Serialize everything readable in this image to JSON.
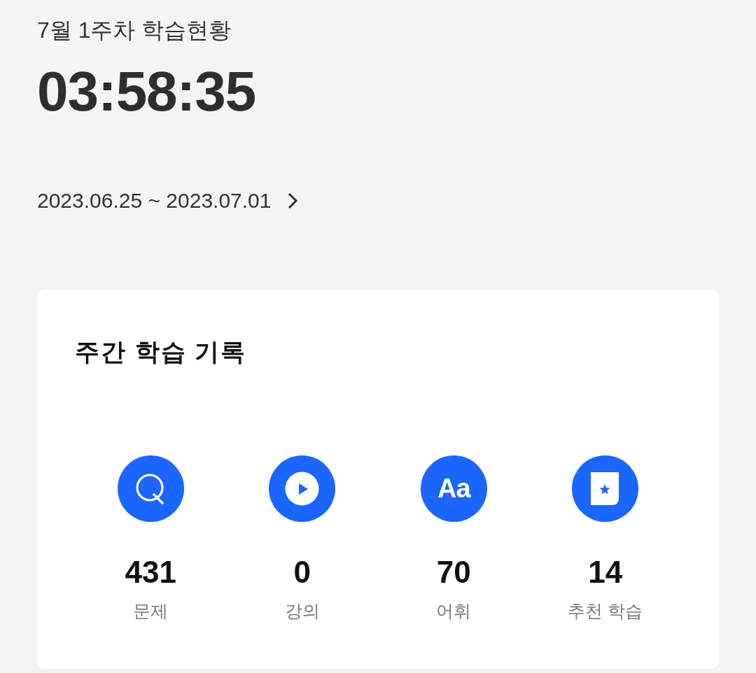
{
  "header": {
    "title": "7월 1주차 학습현황",
    "total_time": "03:58:35",
    "date_range": "2023.06.25 ~ 2023.07.01"
  },
  "weekly_card": {
    "title": "주간 학습 기록",
    "stats": [
      {
        "kind": "question",
        "value": "431",
        "label": "문제"
      },
      {
        "kind": "play",
        "value": "0",
        "label": "강의"
      },
      {
        "kind": "letters",
        "icon_text": "Aa",
        "value": "70",
        "label": "어휘"
      },
      {
        "kind": "bookmark",
        "value": "14",
        "label": "추천 학습"
      }
    ]
  }
}
